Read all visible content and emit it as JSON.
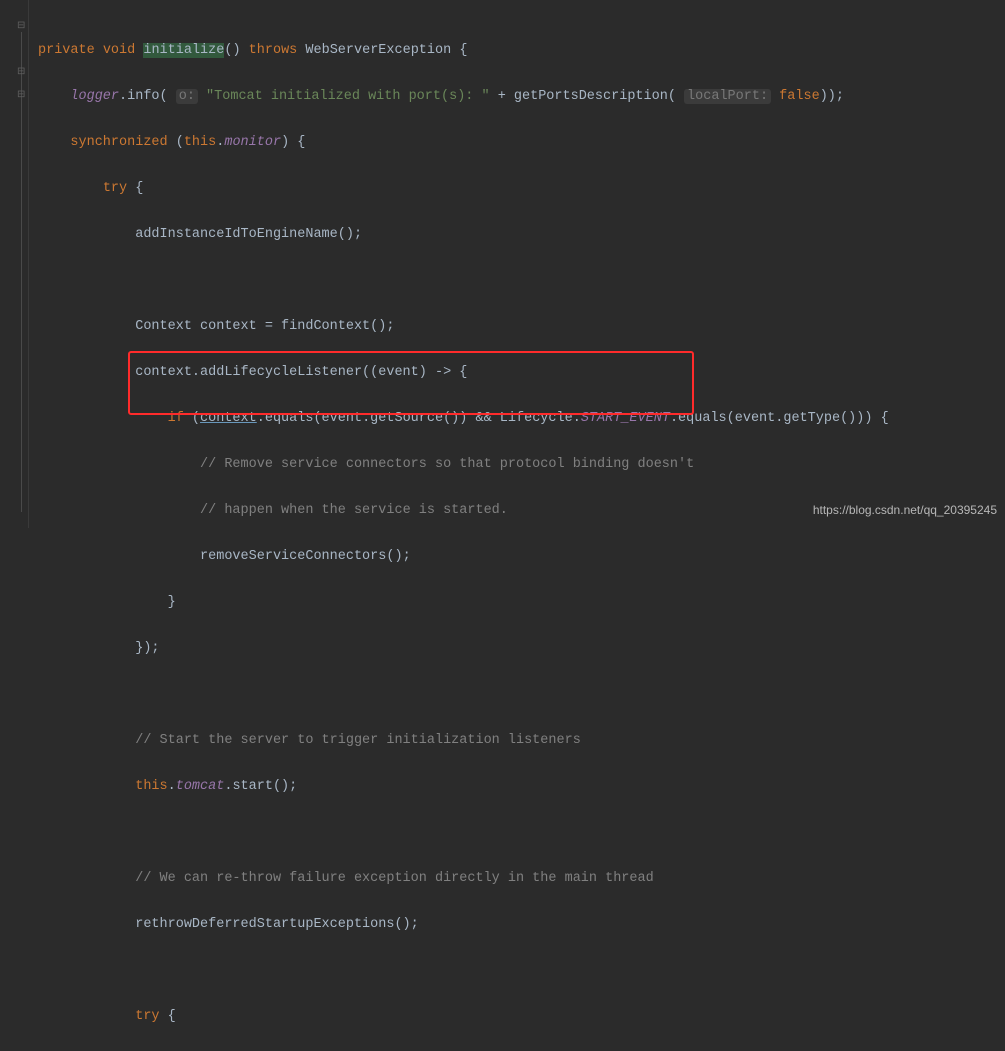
{
  "code": {
    "l1": {
      "kw_private": "private",
      "kw_void": "void",
      "method": "initialize",
      "paren": "()",
      "kw_throws": "throws",
      "exc": "WebServerException {"
    },
    "l2": {
      "logger": "logger",
      "info": ".info(",
      "hint_o": "o:",
      "str": "\"Tomcat initialized with port(s): \"",
      "plus": " + getPortsDescription(",
      "hint_lp": "localPort:",
      "kw_false": "false",
      "closeln": "));"
    },
    "l3": {
      "kw_sync": "synchronized",
      "open": " (",
      "kw_this": "this",
      "dot": ".",
      "monitor": "monitor",
      "close": ") {"
    },
    "l4": {
      "kw_try": "try",
      "brace": " {"
    },
    "l5": {
      "call": "addInstanceIdToEngineName();"
    },
    "l6": {
      "txt": "Context context = findContext();"
    },
    "l7": {
      "txt": "context.addLifecycleListener((event) -> {"
    },
    "l8": {
      "kw_if": "if",
      "open": " (",
      "ctx": "context",
      "mid": ".equals(event.getSource()) && Lifecycle.",
      "se": "START_EVENT",
      "rest": ".equals(event.getType())) {"
    },
    "l9": {
      "cmt": "// Remove service connectors so that protocol binding doesn't"
    },
    "l10": {
      "cmt": "// happen when the service is started."
    },
    "l11": {
      "call": "removeServiceConnectors();"
    },
    "l12": {
      "brace": "}"
    },
    "l13": {
      "close": "});"
    },
    "l14": {
      "cmt": "// Start the server to trigger initialization listeners"
    },
    "l15": {
      "kw_this": "this",
      "dot1": ".",
      "tomcat": "tomcat",
      "rest": ".start();"
    },
    "l16": {
      "cmt": "// We can re-throw failure exception directly in the main thread"
    },
    "l17": {
      "call": "rethrowDeferredStartupExceptions();"
    },
    "l18": {
      "kw_try": "try",
      "brace": " {"
    }
  },
  "watermark": "https://blog.csdn.net/qq_20395245"
}
